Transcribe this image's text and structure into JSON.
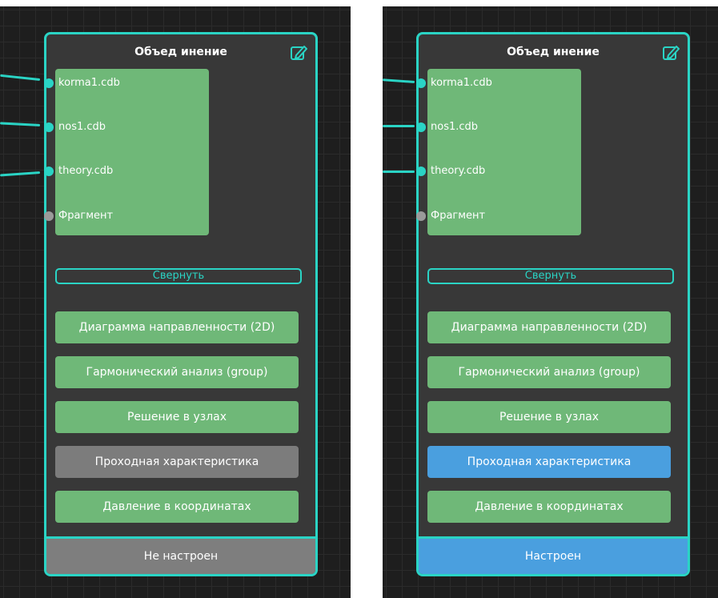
{
  "colors": {
    "accent": "#2ad4c5",
    "green": "#6fb878",
    "gray": "#7c7c7c",
    "blue": "#4a9fdf",
    "node_bg": "#383838",
    "canvas_bg": "#1e1e1e"
  },
  "left_node": {
    "title": "Объед инение",
    "edit_icon": "pencil-icon",
    "ports": [
      {
        "label": "korma1.cdb",
        "linked": true
      },
      {
        "label": "nos1.cdb",
        "linked": true
      },
      {
        "label": "theory.cdb",
        "linked": true
      },
      {
        "label": "Фрагмент",
        "linked": false
      }
    ],
    "collapse_label": "Свернуть",
    "actions": [
      {
        "label": "Диаграмма направленности (2D)",
        "state": "green"
      },
      {
        "label": "Гармонический анализ (group)",
        "state": "green"
      },
      {
        "label": "Решение в узлах",
        "state": "green"
      },
      {
        "label": "Проходная характеристика",
        "state": "gray"
      },
      {
        "label": "Давление в координатах",
        "state": "green"
      }
    ],
    "status": "Не настроен"
  },
  "right_node": {
    "title": "Объед инение",
    "edit_icon": "pencil-icon",
    "ports": [
      {
        "label": "korma1.cdb",
        "linked": true
      },
      {
        "label": "nos1.cdb",
        "linked": true
      },
      {
        "label": "theory.cdb",
        "linked": true
      },
      {
        "label": "Фрагмент",
        "linked": false
      }
    ],
    "collapse_label": "Свернуть",
    "actions": [
      {
        "label": "Диаграмма направленности (2D)",
        "state": "green"
      },
      {
        "label": "Гармонический анализ (group)",
        "state": "green"
      },
      {
        "label": "Решение в узлах",
        "state": "green"
      },
      {
        "label": "Проходная характеристика",
        "state": "blue"
      },
      {
        "label": "Давление в координатах",
        "state": "green"
      }
    ],
    "status": "Настроен"
  }
}
